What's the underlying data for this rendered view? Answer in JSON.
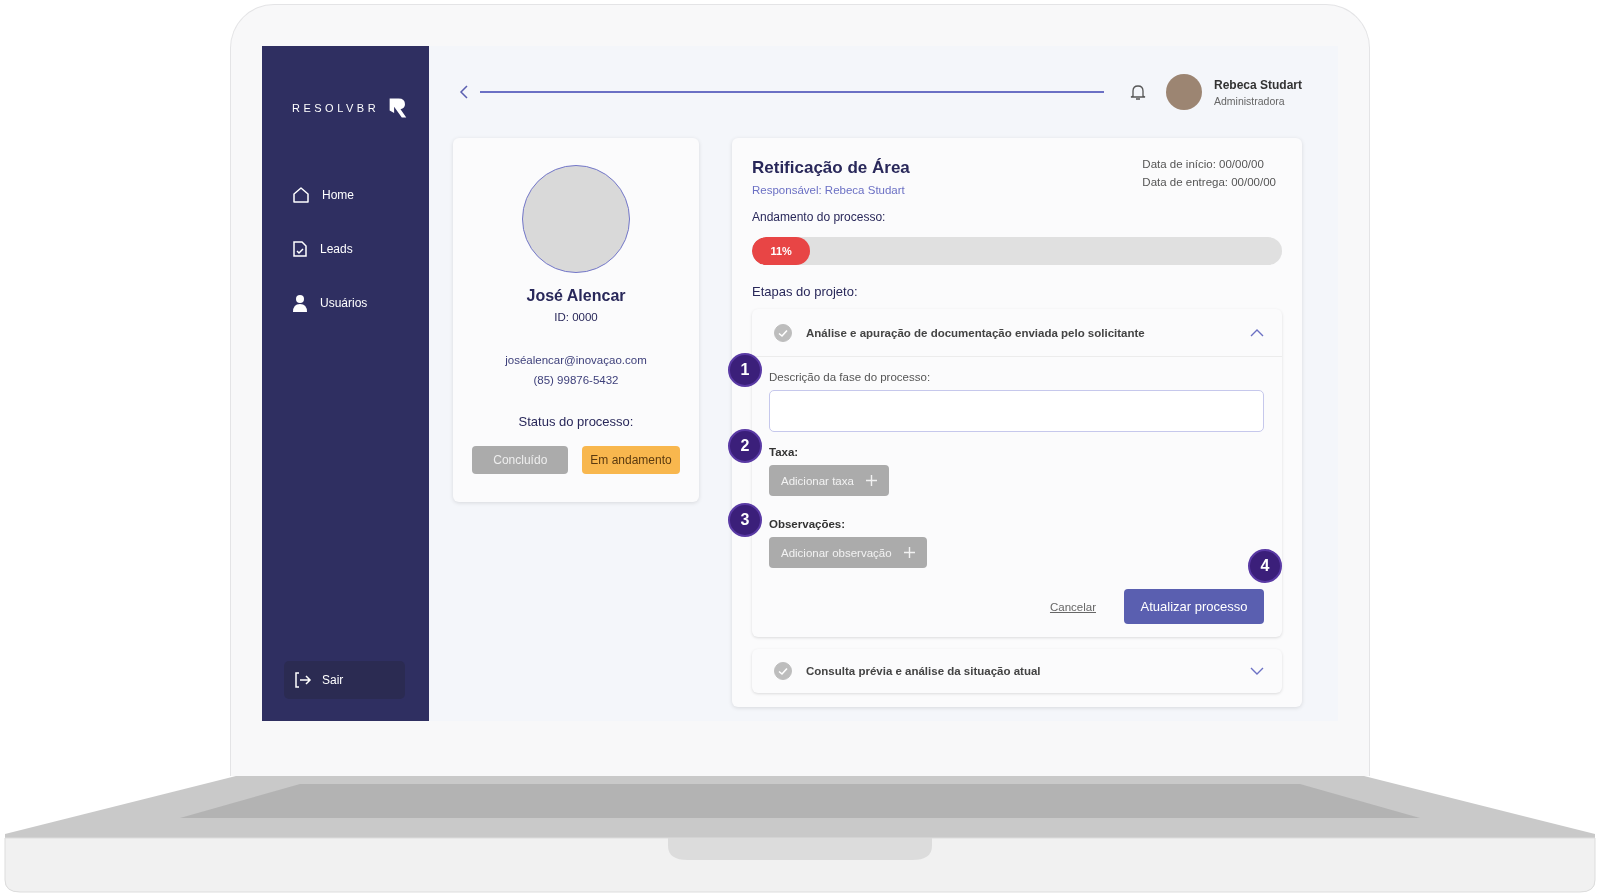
{
  "sidebar": {
    "logo": "RESOLVBR",
    "items": [
      {
        "label": "Home",
        "kind": "home"
      },
      {
        "label": "Leads",
        "kind": "document"
      },
      {
        "label": "Usuários",
        "kind": "user"
      }
    ],
    "logout": "Sair"
  },
  "header": {
    "user_name": "Rebeca Studart",
    "user_role": "Administradora"
  },
  "profile": {
    "name": "José Alencar",
    "id": "ID: 0000",
    "email": "joséalencar@inovaçao.com",
    "phone": "(85) 99876-5432",
    "status_label": "Status do processo:",
    "statuses": [
      {
        "label": "Concluído",
        "selected": false
      },
      {
        "label": "Em andamento",
        "selected": true
      }
    ]
  },
  "process": {
    "title": "Retificação de Área",
    "responsible": "Responsável: Rebeca Studart",
    "dates": [
      "Data de início: 00/00/00",
      "Data de entrega: 00/00/00"
    ],
    "progress_label": "Andamento do processo:",
    "progress": {
      "level": 0.11,
      "reading": "11%"
    },
    "stages_label": "Etapas do projeto:",
    "stages": [
      {
        "title": "Análise e apuração de documentação enviada pelo solicitante",
        "completed": true,
        "expanded": true,
        "form": {
          "description_label": "Descrição da fase do processo:",
          "tax_label": "Taxa:",
          "tax_button": "Adicionar taxa",
          "notes_label": "Observações:",
          "notes_button": "Adicionar observação",
          "cancel": "Cancelar",
          "submit": "Atualizar processo"
        }
      },
      {
        "title": "Consulta prévia e análise da situação atual",
        "completed": true,
        "expanded": false
      }
    ]
  },
  "annotations": [
    "1",
    "2",
    "3",
    "4"
  ]
}
